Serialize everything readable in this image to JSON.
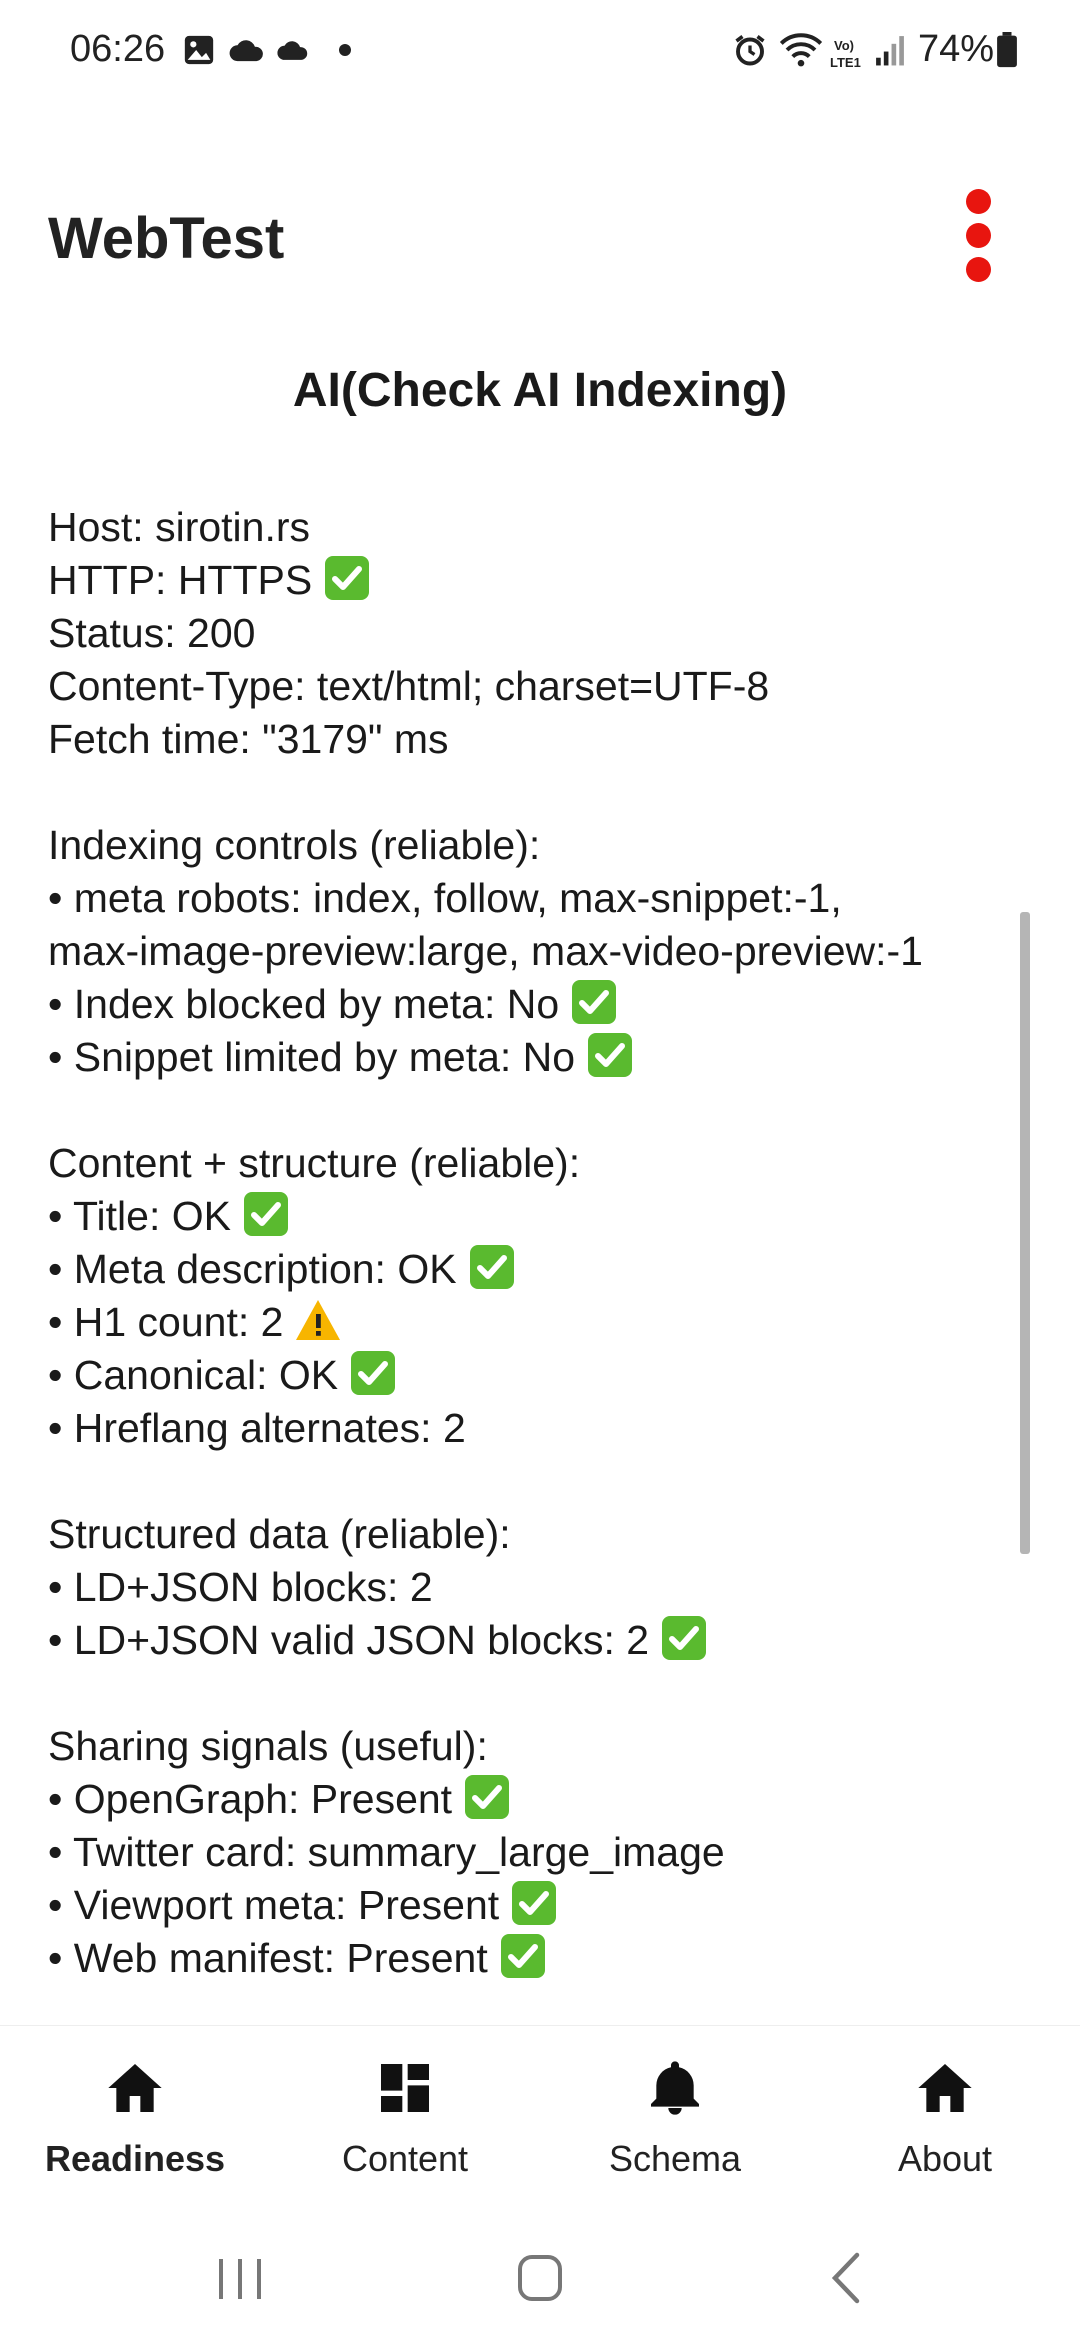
{
  "status_bar": {
    "time": "06:26",
    "battery": "74%",
    "icons": [
      "image-icon",
      "cloud-icon",
      "cloud-icon",
      "dot-icon",
      "alarm-icon",
      "wifi-icon",
      "volte-icon",
      "signal-icon",
      "battery-icon"
    ],
    "volte_label": "VoLTE1"
  },
  "app": {
    "title": "WebTest",
    "menu_icon": "more-vert-icon",
    "accent": "#e8150f"
  },
  "page": {
    "heading": "AI(Check AI Indexing)"
  },
  "report": {
    "partial_top": "Host: sirotin.rs",
    "lines": [
      {
        "text": "Host: sirotin.rs",
        "status": null
      },
      {
        "text": "HTTP: HTTPS",
        "status": "check"
      },
      {
        "text": "Status: 200",
        "status": null
      },
      {
        "text": "Content-Type: text/html; charset=UTF-8",
        "status": null
      },
      {
        "text": "Fetch time: \"3179\" ms",
        "status": null
      },
      {
        "text": "",
        "status": null
      },
      {
        "text": "Indexing controls (reliable):",
        "status": null
      },
      {
        "text": "• meta robots: index, follow, max-snippet:-1,",
        "status": null
      },
      {
        "text": "max-image-preview:large, max-video-preview:-1",
        "status": null
      },
      {
        "text": "• Index blocked by meta: No",
        "status": "check"
      },
      {
        "text": "• Snippet limited by meta: No",
        "status": "check"
      },
      {
        "text": "",
        "status": null
      },
      {
        "text": "Content + structure (reliable):",
        "status": null
      },
      {
        "text": "• Title: OK",
        "status": "check"
      },
      {
        "text": "• Meta description: OK",
        "status": "check"
      },
      {
        "text": "• H1 count: 2",
        "status": "warning"
      },
      {
        "text": "• Canonical: OK",
        "status": "check"
      },
      {
        "text": "• Hreflang alternates: 2",
        "status": null
      },
      {
        "text": "",
        "status": null
      },
      {
        "text": "Structured data (reliable):",
        "status": null
      },
      {
        "text": "• LD+JSON blocks: 2",
        "status": null
      },
      {
        "text": "• LD+JSON valid JSON blocks: 2",
        "status": "check"
      },
      {
        "text": "",
        "status": null
      },
      {
        "text": "Sharing signals (useful):",
        "status": null
      },
      {
        "text": "• OpenGraph: Present",
        "status": "check"
      },
      {
        "text": "• Twitter card: summary_large_image",
        "status": null
      },
      {
        "text": "• Viewport meta: Present",
        "status": "check"
      },
      {
        "text": "• Web manifest: Present",
        "status": "check"
      }
    ]
  },
  "bottom_nav": {
    "items": [
      {
        "label": "Readiness",
        "icon": "home-icon",
        "active": true
      },
      {
        "label": "Content",
        "icon": "dashboard-icon",
        "active": false
      },
      {
        "label": "Schema",
        "icon": "bell-icon",
        "active": false
      },
      {
        "label": "About",
        "icon": "home-icon",
        "active": false
      }
    ]
  },
  "system_nav": {
    "buttons": [
      "recents-icon",
      "home-circle-icon",
      "back-icon"
    ]
  }
}
